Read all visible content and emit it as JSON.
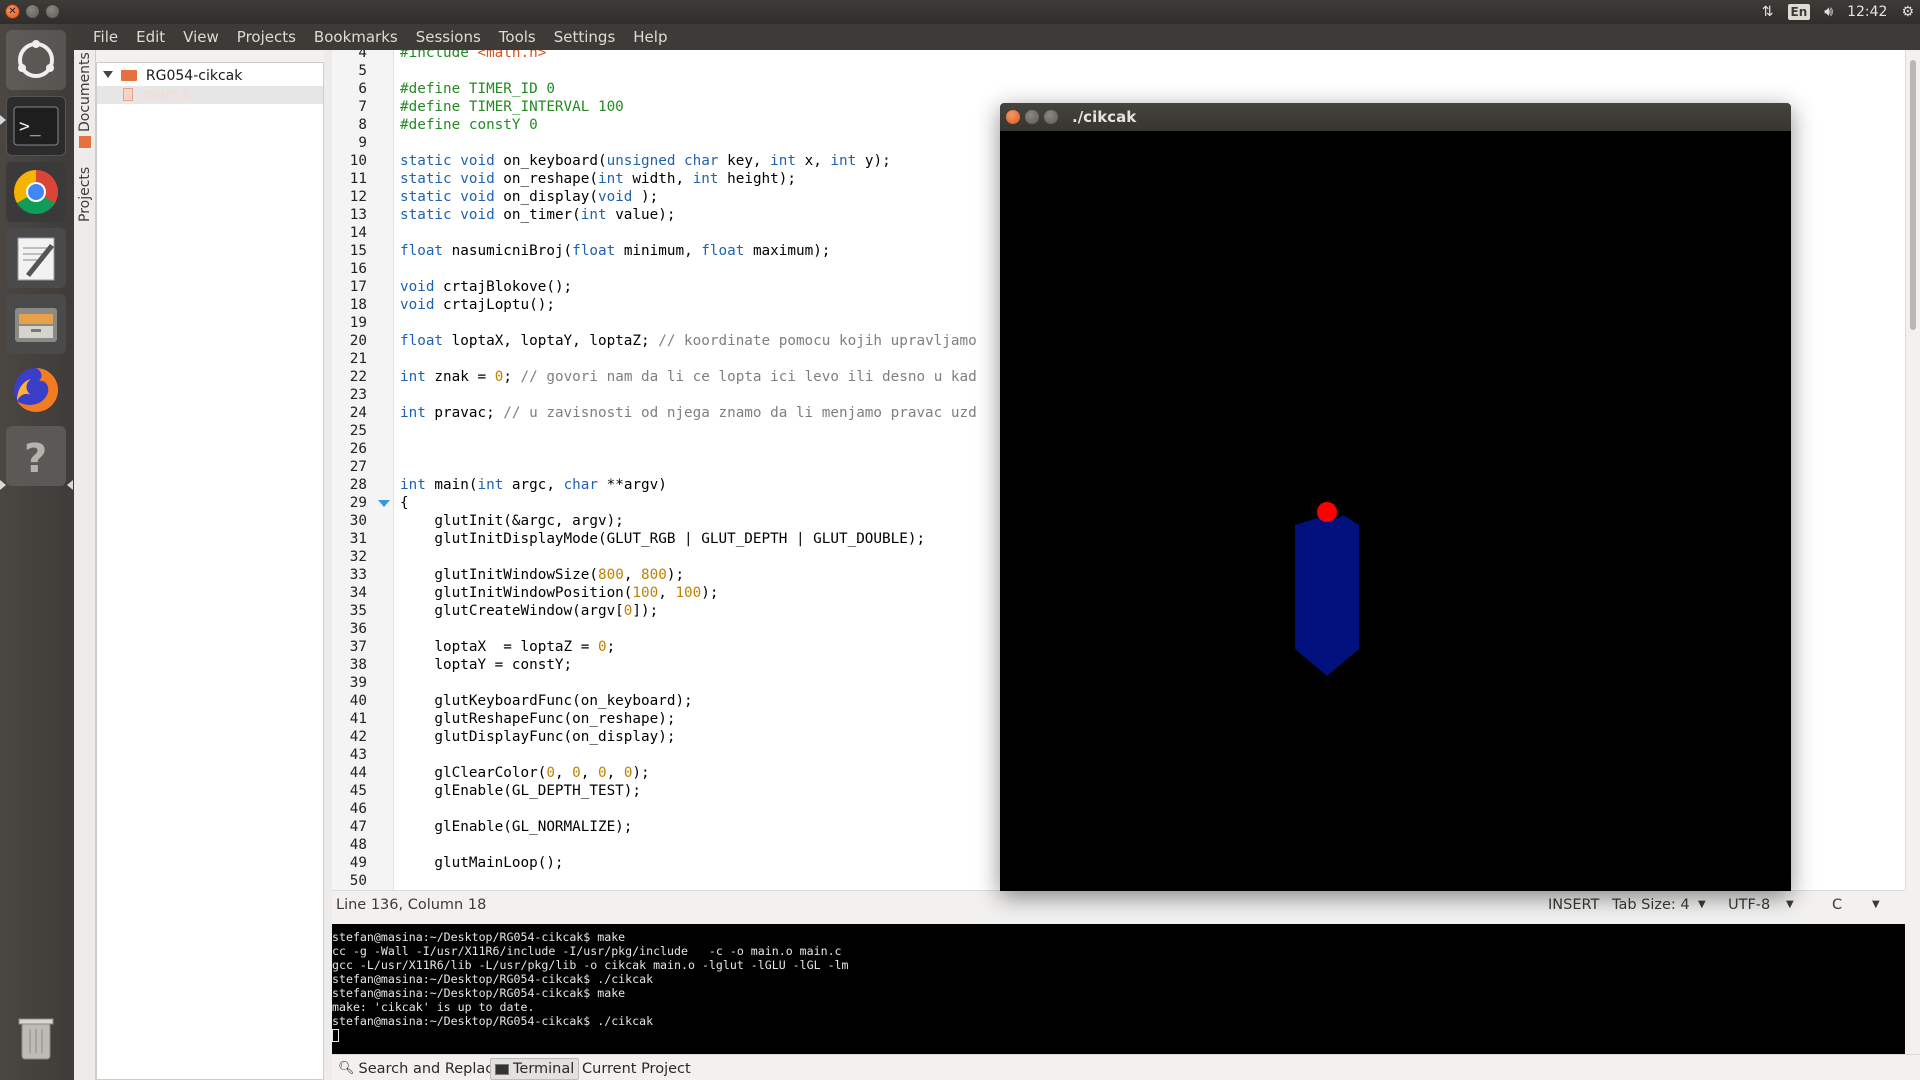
{
  "topbar": {
    "keyboard_layout": "En",
    "clock": "12:42",
    "icons": [
      "network-arrows-icon",
      "keyboard-icon",
      "volume-icon",
      "gear-icon"
    ]
  },
  "menubar": {
    "items": [
      {
        "label": "File"
      },
      {
        "label": "Edit"
      },
      {
        "label": "View"
      },
      {
        "label": "Projects"
      },
      {
        "label": "Bookmarks"
      },
      {
        "label": "Sessions"
      },
      {
        "label": "Tools"
      },
      {
        "label": "Settings"
      },
      {
        "label": "Help"
      }
    ]
  },
  "launcher": {
    "apps": [
      "dash-icon",
      "terminal-icon",
      "chrome-icon",
      "text-editor-icon",
      "file-manager-icon",
      "firefox-icon",
      "help-icon",
      "trash-icon"
    ]
  },
  "sidetabs": {
    "documents": "Documents",
    "projects": "Projects"
  },
  "project_tree": {
    "project": "RG054-cikcak",
    "file": "main.c"
  },
  "editor": {
    "lines": [
      {
        "n": "4",
        "tokens": [
          [
            "pp",
            "#include "
          ],
          [
            "str",
            "<math.h>"
          ]
        ]
      },
      {
        "n": "5",
        "tokens": []
      },
      {
        "n": "6",
        "tokens": [
          [
            "pp",
            "#define TIMER_ID 0"
          ]
        ]
      },
      {
        "n": "7",
        "tokens": [
          [
            "pp",
            "#define TIMER_INTERVAL 100"
          ]
        ]
      },
      {
        "n": "8",
        "tokens": [
          [
            "pp",
            "#define constY 0"
          ]
        ]
      },
      {
        "n": "9",
        "tokens": []
      },
      {
        "n": "10",
        "tokens": [
          [
            "kw",
            "static void"
          ],
          [
            "",
            "on_keyboard("
          ],
          [
            "kw",
            "unsigned char"
          ],
          [
            "",
            " key, "
          ],
          [
            "kw",
            "int"
          ],
          [
            "",
            " x, "
          ],
          [
            "kw",
            "int"
          ],
          [
            "",
            " y);"
          ]
        ]
      },
      {
        "n": "11",
        "tokens": [
          [
            "kw",
            "static void"
          ],
          [
            "",
            "on_reshape("
          ],
          [
            "kw",
            "int"
          ],
          [
            "",
            " width, "
          ],
          [
            "kw",
            "int"
          ],
          [
            "",
            " height);"
          ]
        ]
      },
      {
        "n": "12",
        "tokens": [
          [
            "kw",
            "static void"
          ],
          [
            "",
            "on_display("
          ],
          [
            "kw",
            "void"
          ],
          [
            "",
            ");"
          ]
        ]
      },
      {
        "n": "13",
        "tokens": [
          [
            "kw",
            "static void"
          ],
          [
            "",
            "on_timer("
          ],
          [
            "kw",
            "int"
          ],
          [
            "",
            " value);"
          ]
        ]
      },
      {
        "n": "14",
        "tokens": []
      },
      {
        "n": "15",
        "tokens": [
          [
            "kw",
            "float"
          ],
          [
            "",
            " nasumicniBroj("
          ],
          [
            "kw",
            "float"
          ],
          [
            "",
            " minimum, "
          ],
          [
            "kw",
            "float"
          ],
          [
            "",
            " maximum);"
          ]
        ]
      },
      {
        "n": "16",
        "tokens": []
      },
      {
        "n": "17",
        "tokens": [
          [
            "kw",
            "void"
          ],
          [
            "",
            " crtajBlokove();"
          ]
        ]
      },
      {
        "n": "18",
        "tokens": [
          [
            "kw",
            "void"
          ],
          [
            "",
            " crtajLoptu();"
          ]
        ]
      },
      {
        "n": "19",
        "tokens": []
      },
      {
        "n": "20",
        "tokens": [
          [
            "kw",
            "float"
          ],
          [
            "",
            " loptaX, loptaY, loptaZ; "
          ],
          [
            "cm",
            "// koordinate pomocu kojih upravljamo"
          ]
        ]
      },
      {
        "n": "21",
        "tokens": []
      },
      {
        "n": "22",
        "tokens": [
          [
            "kw",
            "int"
          ],
          [
            "",
            " znak = "
          ],
          [
            "num",
            "0"
          ],
          [
            "",
            "; "
          ],
          [
            "cm",
            "// govori nam da li ce lopta ici levo ili desno u kad"
          ]
        ]
      },
      {
        "n": "23",
        "tokens": []
      },
      {
        "n": "24",
        "tokens": [
          [
            "kw",
            "int"
          ],
          [
            "",
            " pravac; "
          ],
          [
            "cm",
            "// u zavisnosti od njega znamo da li menjamo pravac uzd"
          ]
        ]
      },
      {
        "n": "25",
        "tokens": []
      },
      {
        "n": "26",
        "tokens": []
      },
      {
        "n": "27",
        "tokens": []
      },
      {
        "n": "28",
        "tokens": [
          [
            "kw",
            "int"
          ],
          [
            "",
            " main("
          ],
          [
            "kw",
            "int"
          ],
          [
            "",
            " argc, "
          ],
          [
            "kw",
            "char"
          ],
          [
            "",
            " **argv)"
          ]
        ]
      },
      {
        "n": "29",
        "tokens": [
          [
            "",
            "{"
          ]
        ]
      },
      {
        "n": "30",
        "tokens": [
          [
            "",
            "    glutInit(&argc, argv);"
          ]
        ]
      },
      {
        "n": "31",
        "tokens": [
          [
            "",
            "    glutInitDisplayMode(GLUT_RGB | GLUT_DEPTH | GLUT_DOUBLE);"
          ]
        ]
      },
      {
        "n": "32",
        "tokens": []
      },
      {
        "n": "33",
        "tokens": [
          [
            "",
            "    glutInitWindowSize("
          ],
          [
            "num",
            "800"
          ],
          [
            "",
            ", "
          ],
          [
            "num",
            "800"
          ],
          [
            "",
            ");"
          ]
        ]
      },
      {
        "n": "34",
        "tokens": [
          [
            "",
            "    glutInitWindowPosition("
          ],
          [
            "num",
            "100"
          ],
          [
            "",
            ", "
          ],
          [
            "num",
            "100"
          ],
          [
            "",
            ");"
          ]
        ]
      },
      {
        "n": "35",
        "tokens": [
          [
            "",
            "    glutCreateWindow(argv["
          ],
          [
            "num",
            "0"
          ],
          [
            "",
            "]);"
          ]
        ]
      },
      {
        "n": "36",
        "tokens": []
      },
      {
        "n": "37",
        "tokens": [
          [
            "",
            "    loptaX  = loptaZ = "
          ],
          [
            "num",
            "0"
          ],
          [
            "",
            ";"
          ]
        ]
      },
      {
        "n": "38",
        "tokens": [
          [
            "",
            "    loptaY = constY;"
          ]
        ]
      },
      {
        "n": "39",
        "tokens": []
      },
      {
        "n": "40",
        "tokens": [
          [
            "",
            "    glutKeyboardFunc(on_keyboard);"
          ]
        ]
      },
      {
        "n": "41",
        "tokens": [
          [
            "",
            "    glutReshapeFunc(on_reshape);"
          ]
        ]
      },
      {
        "n": "42",
        "tokens": [
          [
            "",
            "    glutDisplayFunc(on_display);"
          ]
        ]
      },
      {
        "n": "43",
        "tokens": []
      },
      {
        "n": "44",
        "tokens": [
          [
            "",
            "    glClearColor("
          ],
          [
            "num",
            "0"
          ],
          [
            "",
            ", "
          ],
          [
            "num",
            "0"
          ],
          [
            "",
            ", "
          ],
          [
            "num",
            "0"
          ],
          [
            "",
            ", "
          ],
          [
            "num",
            "0"
          ],
          [
            "",
            ");"
          ]
        ]
      },
      {
        "n": "45",
        "tokens": [
          [
            "",
            "    glEnable(GL_DEPTH_TEST);"
          ]
        ]
      },
      {
        "n": "46",
        "tokens": []
      },
      {
        "n": "47",
        "tokens": [
          [
            "",
            "    glEnable(GL_NORMALIZE);"
          ]
        ]
      },
      {
        "n": "48",
        "tokens": []
      },
      {
        "n": "49",
        "tokens": [
          [
            "",
            "    glutMainLoop();"
          ]
        ]
      },
      {
        "n": "50",
        "tokens": []
      }
    ]
  },
  "status": {
    "position": "Line 136, Column 18",
    "mode": "INSERT",
    "tab_size": "Tab Size: 4",
    "encoding": "UTF-8",
    "language": "C"
  },
  "terminal": {
    "lines": [
      "stefan@masina:~/Desktop/RG054-cikcak$ make",
      "cc -g -Wall -I/usr/X11R6/include -I/usr/pkg/include   -c -o main.o main.c",
      "gcc -L/usr/X11R6/lib -L/usr/pkg/lib -o cikcak main.o -lglut -lGLU -lGL -lm",
      "stefan@masina:~/Desktop/RG054-cikcak$ ./cikcak",
      "stefan@masina:~/Desktop/RG054-cikcak$ make",
      "make: 'cikcak' is up to date.",
      "stefan@masina:~/Desktop/RG054-cikcak$ ./cikcak",
      ""
    ]
  },
  "bottom_tabs": [
    {
      "label": "Search and Replace",
      "icon": "search-icon"
    },
    {
      "label": "Terminal",
      "icon": "terminal-icon",
      "active": true
    },
    {
      "label": "Current Project"
    }
  ],
  "gl_window": {
    "title": "./cikcak",
    "background": "#000000",
    "block_color": "#00107d",
    "ball_color": "#ff0000"
  }
}
